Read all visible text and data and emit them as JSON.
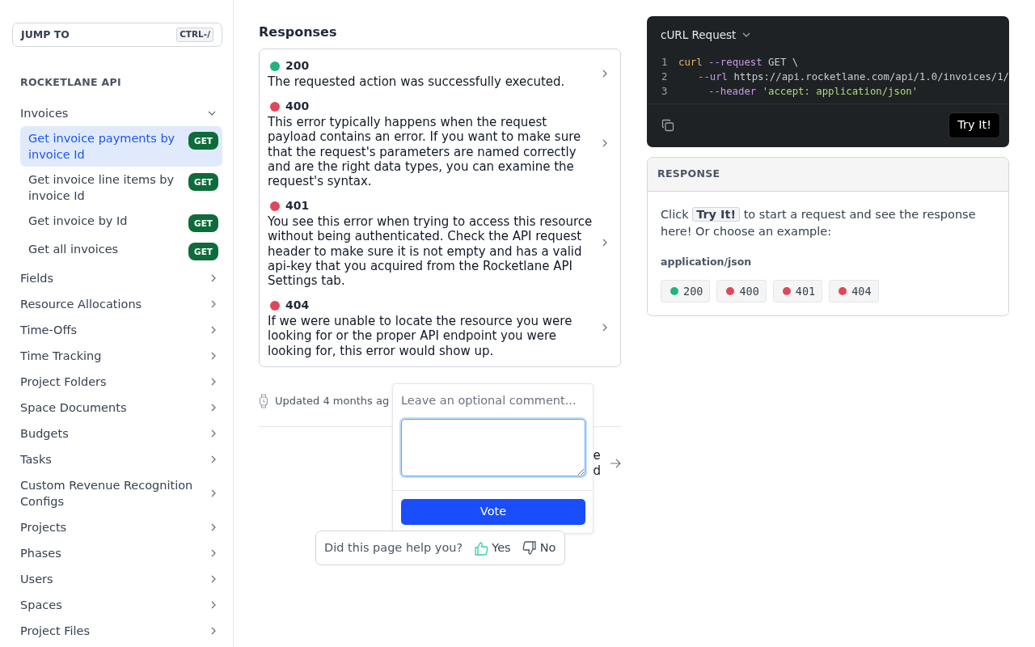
{
  "sidebar": {
    "jump_to": {
      "label": "JUMP TO",
      "shortcut": "CTRL-/"
    },
    "section_title": "ROCKETLANE API",
    "groups": [
      {
        "label": "Invoices",
        "expanded": true,
        "children": [
          {
            "label": "Get invoice payments by invoice Id",
            "method": "GET",
            "selected": true
          },
          {
            "label": "Get invoice line items by invoice Id",
            "method": "GET",
            "selected": false
          },
          {
            "label": "Get invoice by Id",
            "method": "GET",
            "selected": false
          },
          {
            "label": "Get all invoices",
            "method": "GET",
            "selected": false
          }
        ]
      },
      {
        "label": "Fields",
        "expanded": false
      },
      {
        "label": "Resource Allocations",
        "expanded": false
      },
      {
        "label": "Time-Offs",
        "expanded": false
      },
      {
        "label": "Time Tracking",
        "expanded": false
      },
      {
        "label": "Project Folders",
        "expanded": false
      },
      {
        "label": "Space Documents",
        "expanded": false
      },
      {
        "label": "Budgets",
        "expanded": false
      },
      {
        "label": "Tasks",
        "expanded": false
      },
      {
        "label": "Custom Revenue Recognition Configs",
        "expanded": false
      },
      {
        "label": "Projects",
        "expanded": false
      },
      {
        "label": "Phases",
        "expanded": false
      },
      {
        "label": "Users",
        "expanded": false
      },
      {
        "label": "Spaces",
        "expanded": false
      },
      {
        "label": "Project Files",
        "expanded": false
      }
    ]
  },
  "responses": {
    "title": "Responses",
    "items": [
      {
        "code": "200",
        "color": "#1fb57a",
        "description": "The requested action was successfully executed."
      },
      {
        "code": "400",
        "color": "#e0475a",
        "description": "This error typically happens when the request payload contains an error. If you want to make sure that the request's parameters are named correctly and are the right data types, you can examine the request's syntax."
      },
      {
        "code": "401",
        "color": "#e0475a",
        "description": "You see this error when trying to access this resource without being authenticated. Check the API request header to make sure it is not empty and has a valid api-key that you acquired from the Rocketlane API Settings tab."
      },
      {
        "code": "404",
        "color": "#e0475a",
        "description": "If we were unable to locate the resource you were looking for or the proper API endpoint you were looking for, this error would show up."
      }
    ]
  },
  "updated": "Updated 4 months ag",
  "next_link": {
    "lines": [
      "e",
      "d"
    ]
  },
  "comment_popover": {
    "title": "Leave an optional comment...",
    "button": "Vote"
  },
  "feedback": {
    "question": "Did this page help you?",
    "yes": "Yes",
    "no": "No"
  },
  "code_panel": {
    "language": "cURL Request",
    "lines": [
      {
        "number": "1",
        "indented": false,
        "tokens": [
          {
            "text": "curl",
            "kind": "command"
          },
          {
            "text": "--request",
            "kind": "flag"
          },
          {
            "text": "GET \\",
            "kind": "plain"
          }
        ]
      },
      {
        "number": "2",
        "indented": true,
        "tokens": [
          {
            "text": "--url",
            "kind": "flag"
          },
          {
            "text": "https://api.rocketlane.com/api/1.0/invoices/1/",
            "kind": "plain"
          }
        ]
      },
      {
        "number": "3",
        "indented": true,
        "tokens": [
          {
            "text": "--header",
            "kind": "flag"
          },
          {
            "text": "'accept: application/json'",
            "kind": "string"
          }
        ]
      }
    ],
    "button": "Try It!"
  },
  "response_panel": {
    "title": "RESPONSE",
    "text_before": "Click",
    "text_button": "Try It!",
    "text_after": "to start a request and see the response here! Or choose an example:",
    "content_type": "application/json",
    "examples": [
      {
        "code": "200",
        "color": "#1fb57a"
      },
      {
        "code": "400",
        "color": "#e0475a"
      },
      {
        "code": "401",
        "color": "#e0475a"
      },
      {
        "code": "404",
        "color": "#e0475a"
      }
    ]
  }
}
